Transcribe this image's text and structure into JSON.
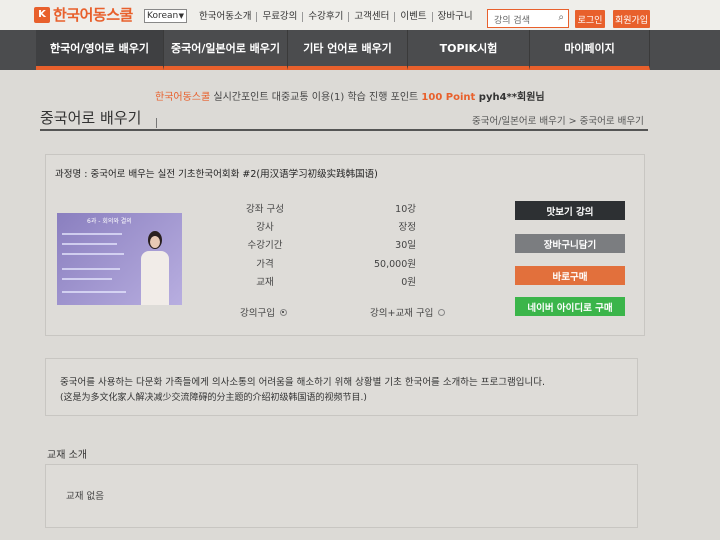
{
  "header": {
    "logo_mark": "K",
    "logo_text": "한국어동스쿨",
    "language": "Korean",
    "menu": [
      "한국어동소개",
      "무료강의",
      "수강후기",
      "고객센터",
      "이벤트",
      "장바구니"
    ],
    "search_placeholder": "강의 검색",
    "login": "로그인",
    "join": "회원가입",
    "accent_color": "#e8602c"
  },
  "nav": {
    "tabs": [
      "한국어/영어로 배우기",
      "중국어/일본어로 배우기",
      "기타 언어로 배우기",
      "TOPIK시험",
      "마이페이지"
    ]
  },
  "points": {
    "brand": "한국어동스쿨",
    "text": " 실시간포인트 대중교통 이용(1) 학습 진행 포인트 ",
    "amount": "100 Point",
    "user": " pyh4**회원님"
  },
  "page": {
    "title": "중국어로 배우기",
    "breadcrumb": "중국어/일본어로 배우기 > 중국어로 배우기"
  },
  "course": {
    "name": "과정명 : 중국어로 배우는 실전 기초한국어회화 #2(用汉语学习初级实践韩国语)",
    "thumb_title": "6과 - 회의와 결의",
    "info": [
      {
        "label": "강좌 구성",
        "value": "10강"
      },
      {
        "label": "강사",
        "value": "장정"
      },
      {
        "label": "수강기간",
        "value": "30일"
      },
      {
        "label": "가격",
        "value": "50,000원"
      },
      {
        "label": "교재",
        "value": "0원"
      }
    ],
    "purchase_options": [
      "강의구입",
      "강의+교재 구입"
    ],
    "buttons": {
      "preview": "맛보기 강의",
      "cart": "장바구니담기",
      "buy": "바로구매",
      "naver": "네이버 아이디로 구매"
    }
  },
  "description": {
    "line1": "중국어를 사용하는 다문화 가족들에게 의사소통의 어려움을 해소하기 위해 상황별 기초 한국어를 소개하는 프로그램입니다.",
    "line2": "(这是为多文化家人解决减少交流障碍的分主题的介绍初级韩国语的视频节目.)"
  },
  "textbook": {
    "title": "교재 소개",
    "content": "교재 없음"
  }
}
